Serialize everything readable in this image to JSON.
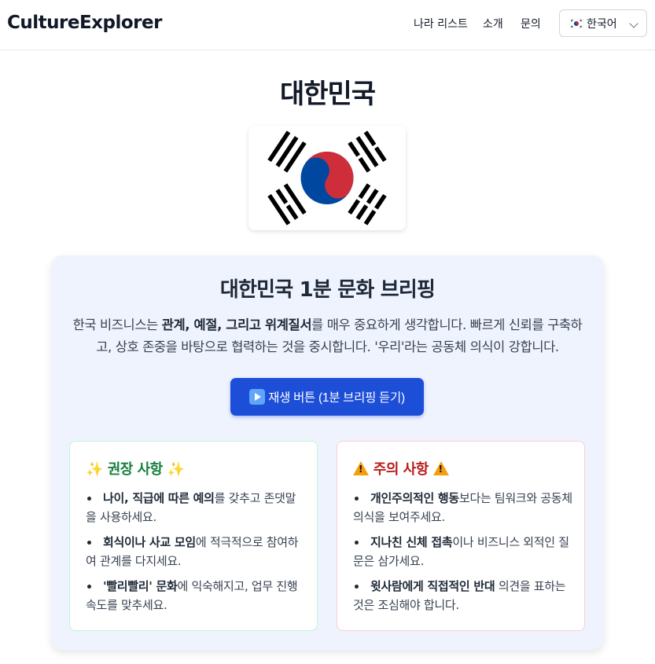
{
  "header": {
    "logo": "CultureExplorer",
    "nav": [
      "나라 리스트",
      "소개",
      "문의"
    ],
    "language": "한국어"
  },
  "country": {
    "name": "대한민국",
    "flag_icon": "south-korea-flag-icon"
  },
  "briefing": {
    "title": "대한민국 1분 문화 브리핑",
    "desc_pre": "한국 비즈니스는 ",
    "desc_bold": "관계, 예절, 그리고 위계질서",
    "desc_post": "를 매우 중요하게 생각합니다. 빠르게 신뢰를 구축하고, 상호 존중을 바탕으로 협력하는 것을 중시합니다. '우리'라는 공동체 의식이 강합니다.",
    "play_label": "재생 버튼 (1분 브리핑 듣기)"
  },
  "dos": {
    "title": "권장 사항",
    "items": [
      {
        "bold": "나이, 직급에 따른 예의",
        "text": "를 갖추고 존댓말을 사용하세요."
      },
      {
        "bold": "회식이나 사교 모임",
        "text": "에 적극적으로 참여하여 관계를 다지세요."
      },
      {
        "bold": "'빨리빨리' 문화",
        "text": "에 익숙해지고, 업무 진행 속도를 맞추세요."
      }
    ]
  },
  "donts": {
    "title": "주의 사항",
    "items": [
      {
        "bold": "개인주의적인 행동",
        "text": "보다는 팀워크와 공동체 의식을 보여주세요."
      },
      {
        "bold": "지나친 신체 접촉",
        "text": "이나 비즈니스 외적인 질문은 삼가세요."
      },
      {
        "bold": "윗사람에게 직접적인 반대",
        "text": " 의견을 표하는 것은 조심해야 합니다."
      }
    ]
  },
  "colors": {
    "accent": "#1d4ed8",
    "do": "#15803d",
    "dont": "#b91c1c",
    "flag_red": "#cd2e3a",
    "flag_blue": "#0047a0"
  }
}
